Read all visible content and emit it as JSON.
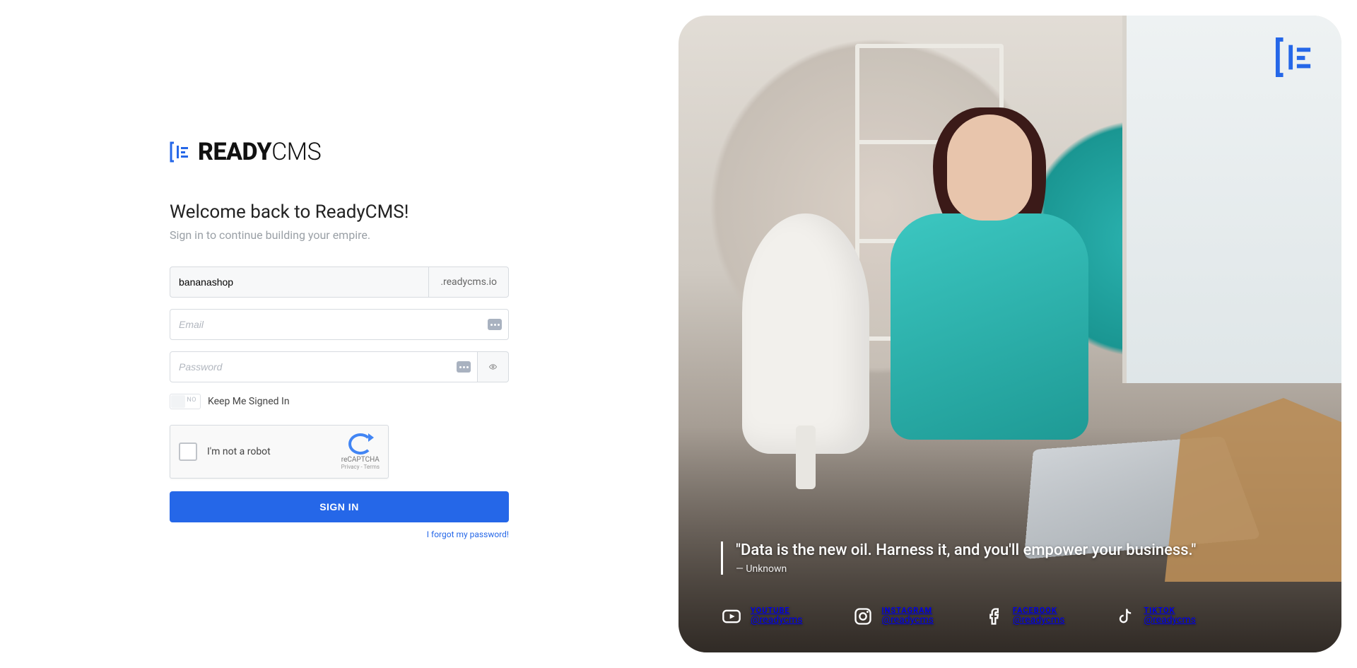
{
  "brand": {
    "name_bold": "READY",
    "name_thin": "CMS"
  },
  "heading": "Welcome back to ReadyCMS!",
  "subheading": "Sign in to continue building your empire.",
  "form": {
    "domain_value": "bananashop",
    "domain_suffix": ".readycms.io",
    "email_placeholder": "Email",
    "password_placeholder": "Password",
    "keep_signed_label": "Keep Me Signed In",
    "toggle_off_text": "NO",
    "captcha_label": "I'm not a robot",
    "captcha_brand": "reCAPTCHA",
    "captcha_terms": "Privacy - Terms",
    "signin_label": "SIGN IN",
    "forgot_label": "I forgot my password!"
  },
  "hero": {
    "quote": "\"Data is the new oil. Harness it, and you'll empower your business.\"",
    "author": "— Unknown",
    "socials": [
      {
        "platform": "YOUTUBE",
        "handle": "@readycms"
      },
      {
        "platform": "INSTAGRAM",
        "handle": "@readycms"
      },
      {
        "platform": "FACEBOOK",
        "handle": "@readycms"
      },
      {
        "platform": "TIKTOK",
        "handle": "@readycms"
      }
    ]
  },
  "colors": {
    "accent": "#2567e8"
  }
}
